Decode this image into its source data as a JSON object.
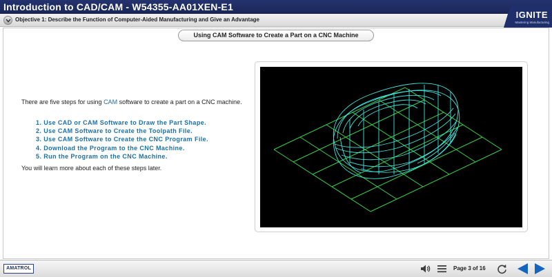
{
  "header": {
    "title": "Introduction to CAD/CAM - W54355-AA01XEN-E1",
    "objective": "Objective 1: Describe the Function of Computer-Aided Manufacturing and Give an Advantage",
    "logo_word": "IGNITE",
    "logo_tagline": "Mastering Manufacturing"
  },
  "content": {
    "heading": "Using CAM Software to Create a Part on a CNC Machine",
    "intro_before": "There are five steps for using ",
    "intro_link": "CAM",
    "intro_after": " software to create a part on a CNC machine.",
    "steps": [
      "1. Use CAD or CAM Software to Draw the Part Shape.",
      "2. Use CAM Software to Create the Toolpath File.",
      "3. Use CAM Software to Create the CNC Program File.",
      "4. Download the Program to the CNC Machine.",
      "5. Run the Program on the CNC Machine."
    ],
    "outro": "You will learn more about each of these steps later.",
    "image_icon": "wireframe-part-image"
  },
  "footer": {
    "brand": "AMATROL",
    "page_label": "Page 3 of 16",
    "icons": [
      "speaker-icon",
      "menu-icon",
      "replay-icon",
      "back-arrow-icon",
      "next-arrow-icon"
    ]
  },
  "colors": {
    "title_bar": "#1f2f6b",
    "link_blue": "#1a6fb3",
    "step_blue": "#1b6fa7",
    "nav_arrow": "#1565c0",
    "wireframe_cyan": "#3fe6e0",
    "grid_green": "#36d14a"
  }
}
